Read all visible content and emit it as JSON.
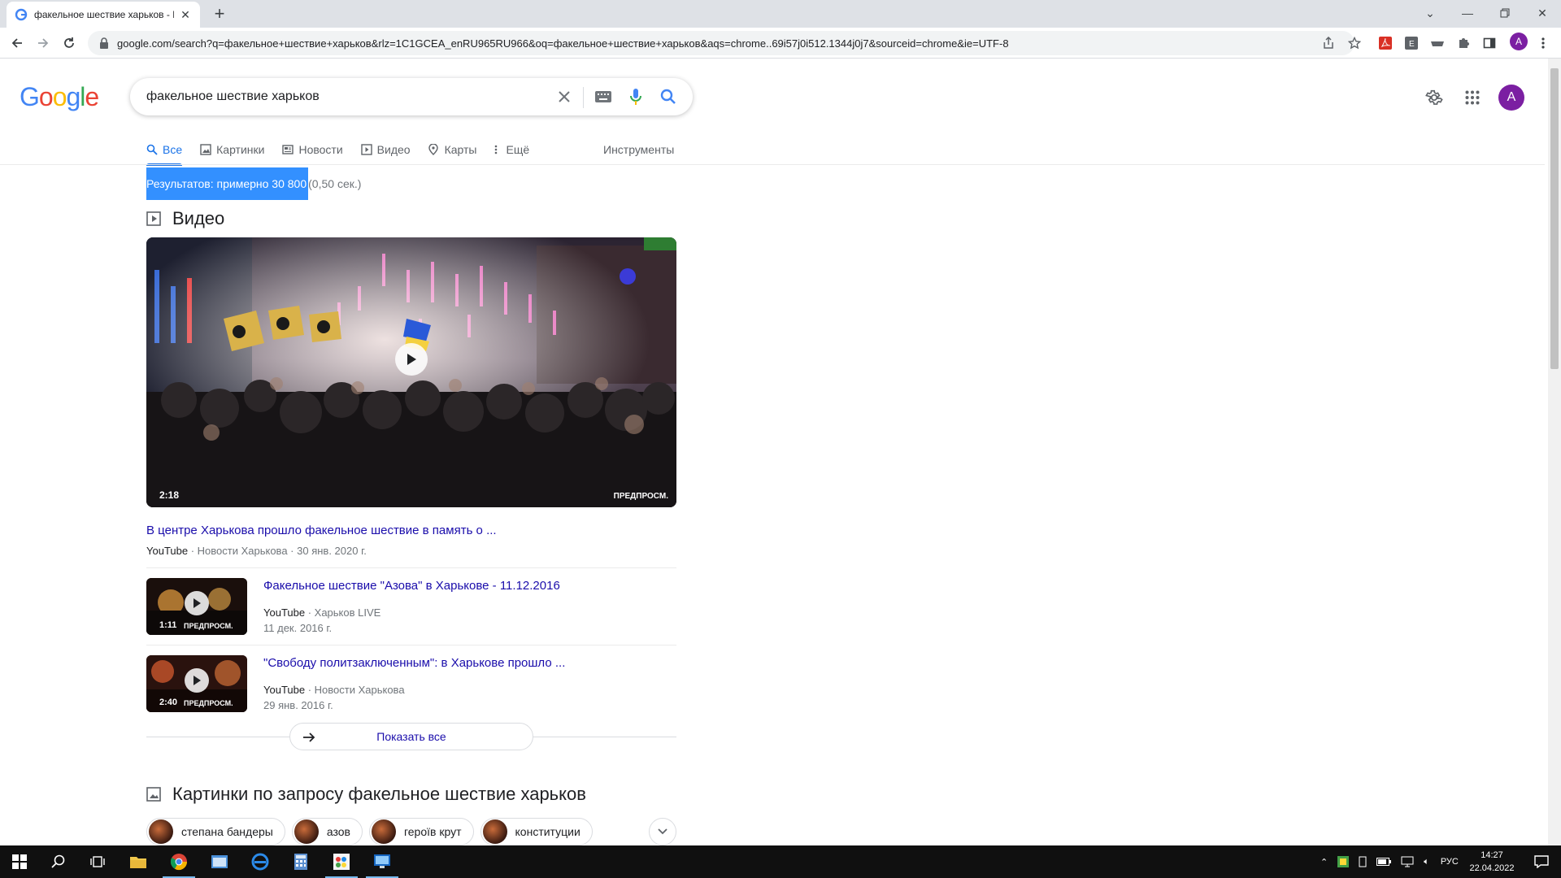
{
  "browser": {
    "tab_title": "факельное шествие харьков - П",
    "url": "google.com/search?q=факельное+шествие+харьков&rlz=1C1GCEA_enRU965RU966&oq=факельное+шествие+харьков&aqs=chrome..69i57j0i512.1344j0j7&sourceid=chrome&ie=UTF-8",
    "profile_initial": "A"
  },
  "google": {
    "logo": [
      "G",
      "o",
      "o",
      "g",
      "l",
      "e"
    ],
    "logo_colors": [
      "#4285f4",
      "#ea4335",
      "#fbbc05",
      "#4285f4",
      "#34a853",
      "#ea4335"
    ],
    "query": "факельное шествие харьков",
    "avatar_initial": "A",
    "tabs": [
      {
        "label": "Все",
        "icon": "search-icon",
        "active": true
      },
      {
        "label": "Картинки",
        "icon": "image-icon"
      },
      {
        "label": "Новости",
        "icon": "news-icon"
      },
      {
        "label": "Видео",
        "icon": "video-icon"
      },
      {
        "label": "Карты",
        "icon": "map-pin-icon"
      },
      {
        "label": "Ещё",
        "icon": "more-vert-icon"
      }
    ],
    "tools_label": "Инструменты",
    "stats_highlight": "Результатов: примерно 30 800",
    "stats_time": "(0,50 сек.)"
  },
  "videos": {
    "section_title": "Видео",
    "featured": {
      "duration": "2:18",
      "preview_label": "ПРЕДПРОСМ.",
      "title": "В центре Харькова прошло факельное шествие в память о ...",
      "source": "YouTube",
      "channel": "Новости Харькова",
      "date": "30 янв. 2020 г."
    },
    "items": [
      {
        "duration": "1:11",
        "preview_label": "ПРЕДПРОСМ.",
        "title": "Факельное шествие \"Азова\" в Харькове - 11.12.2016",
        "source": "YouTube",
        "channel": "Харьков LIVE",
        "date": "11 дек. 2016 г."
      },
      {
        "duration": "2:40",
        "preview_label": "ПРЕДПРОСМ.",
        "title": "\"Свободу политзаключенным\": в Харькове прошло ...",
        "source": "YouTube",
        "channel": "Новости Харькова",
        "date": "29 янв. 2016 г."
      }
    ],
    "show_all": "Показать все",
    "meta_separator": " · "
  },
  "images": {
    "section_title": "Картинки по запросу факельное шествие харьков",
    "chips": [
      "степана бандеры",
      "азов",
      "героїв крут",
      "конституции"
    ]
  },
  "taskbar": {
    "lang": "РУС",
    "time": "14:27",
    "date": "22.04.2022"
  },
  "colors": {
    "link": "#1a0dab",
    "accent": "#1a73e8",
    "selection": "#3390ff",
    "avatar": "#7b1fa2"
  }
}
